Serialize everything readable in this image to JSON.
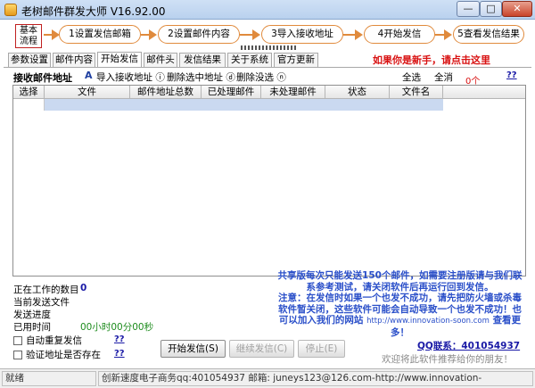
{
  "window": {
    "title": "老树邮件群发大师 V16.92.00",
    "min_label": "—",
    "max_label": "□",
    "close_label": "✕"
  },
  "steps": {
    "basic_flow": [
      "基本",
      "流程"
    ],
    "items": [
      "1设置发信邮箱",
      "2设置邮件内容",
      "3导入接收地址",
      "4开始发信",
      "5查看发信结果"
    ],
    "accent_color": "#e08a3c"
  },
  "tabs": [
    "参数设置",
    "邮件内容",
    "开始发信",
    "邮件头",
    "发信结果",
    "关于系统",
    "官方更新"
  ],
  "active_tab_index": 2,
  "novice_link": "如果你是新手，请点击这里",
  "toolbar": {
    "section_title": "接收邮件地址",
    "import_label": "导入接收地址",
    "delete_selected_label": "删除选中地址",
    "delete_unsent_label": "删除没选",
    "select_all_label": "全选",
    "clear_label": "全消",
    "count_label": "0个",
    "help_label": "??"
  },
  "table": {
    "columns": [
      "选择",
      "文件",
      "邮件地址总数",
      "已处理邮件",
      "未处理邮件",
      "状态",
      "文件名"
    ],
    "rows": [
      {
        "select": "",
        "file": "",
        "total": "",
        "processed": "",
        "unprocessed": "",
        "status": "",
        "filename": ""
      }
    ]
  },
  "stats": {
    "working_label": "正在工作的数目",
    "working_value": "0",
    "current_file_label": "当前发送文件",
    "progress_label": "发送进度",
    "elapsed_label": "已用时间",
    "elapsed_value": "00小时00分00秒",
    "auto_resend_label": "自动重复发信",
    "verify_label": "验证地址是否存在",
    "help_label": "??"
  },
  "buttons": {
    "start": "开始发信(S)",
    "resume": "继续发信(C)",
    "stop": "停止(E)"
  },
  "notice": {
    "line1": "共享版每次只能发送150个邮件，如需要注册版请与我们联系参考测试，请关闭软件后再运行回到发信。",
    "line2": "注意：在发信时如果一个也发不成功，请先把防火墙或杀毒软件暂关闭，这些软件可能会自动导致一个也发不成功！也可以加入我们的网站",
    "site": "http://www.innovation-soon.com",
    "line3": "查看更多！"
  },
  "qq_contact": "QQ联系：401054937",
  "welcome": "欢迎将此软件推荐给你的朋友！",
  "status_bar": {
    "status": "就绪",
    "info": "创新速度电子商务qq:401054937 邮箱: juneys123@126.com-http://www.innovation-"
  }
}
